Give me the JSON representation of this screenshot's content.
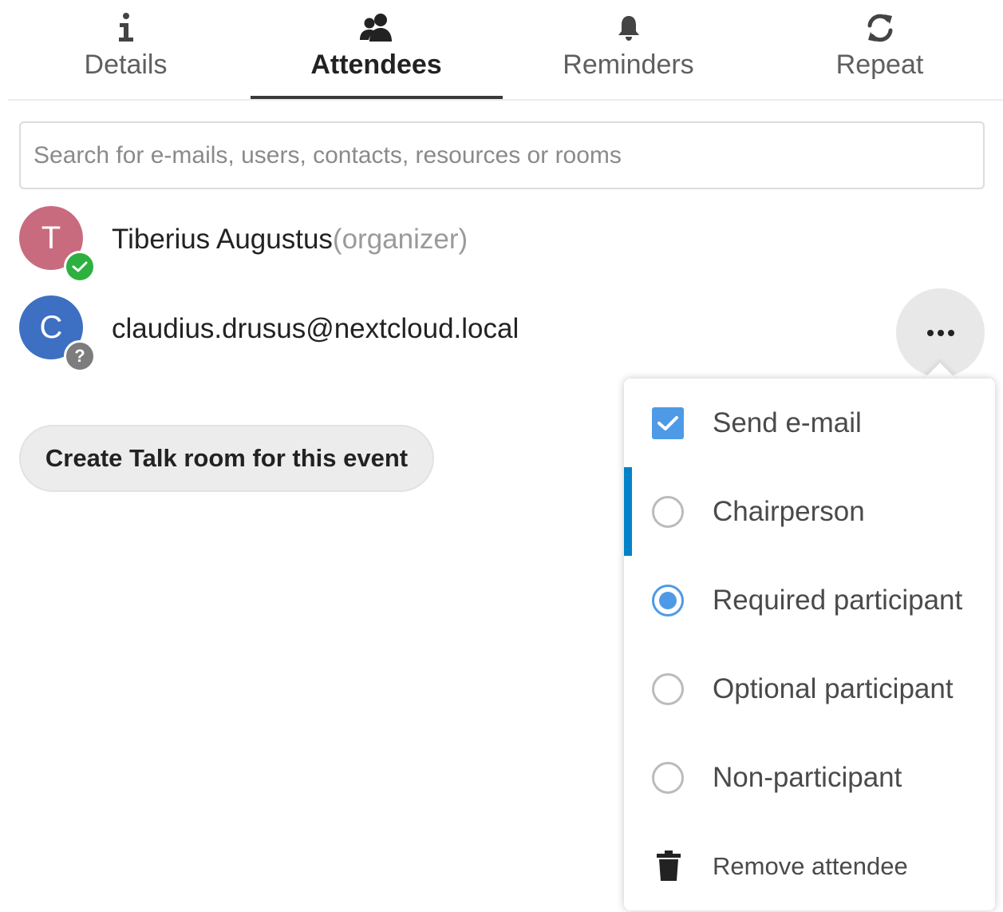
{
  "tabs": [
    {
      "label": "Details",
      "icon": "info-icon",
      "active": false
    },
    {
      "label": "Attendees",
      "icon": "people-icon",
      "active": true
    },
    {
      "label": "Reminders",
      "icon": "bell-icon",
      "active": false
    },
    {
      "label": "Repeat",
      "icon": "repeat-icon",
      "active": false
    }
  ],
  "search": {
    "placeholder": "Search for e-mails, users, contacts, resources or rooms",
    "value": ""
  },
  "attendees": [
    {
      "initial": "T",
      "name": "Tiberius Augustus",
      "role": "(organizer)",
      "avatar_color": "#c96b7e",
      "status": "accepted",
      "status_color": "#2eb040"
    },
    {
      "initial": "C",
      "name": "claudius.drusus@nextcloud.local",
      "role": "",
      "avatar_color": "#3d6fc2",
      "status": "unknown",
      "status_badge": "?",
      "status_color": "#7d7d7d"
    }
  ],
  "talk_button": {
    "label": "Create Talk room for this event"
  },
  "attendee_menu": {
    "items": [
      {
        "type": "checkbox",
        "label": "Send e-mail",
        "checked": true
      },
      {
        "type": "radio",
        "label": "Chairperson",
        "checked": false,
        "focused": true
      },
      {
        "type": "radio",
        "label": "Required participant",
        "checked": true
      },
      {
        "type": "radio",
        "label": "Optional participant",
        "checked": false
      },
      {
        "type": "radio",
        "label": "Non-participant",
        "checked": false
      },
      {
        "type": "action",
        "label": "Remove attendee",
        "icon": "trash-icon"
      }
    ]
  },
  "colors": {
    "accent": "#0082c9",
    "checkbox_blue": "#4f9ae6",
    "active_tab_underline": "#3a3a3a"
  }
}
